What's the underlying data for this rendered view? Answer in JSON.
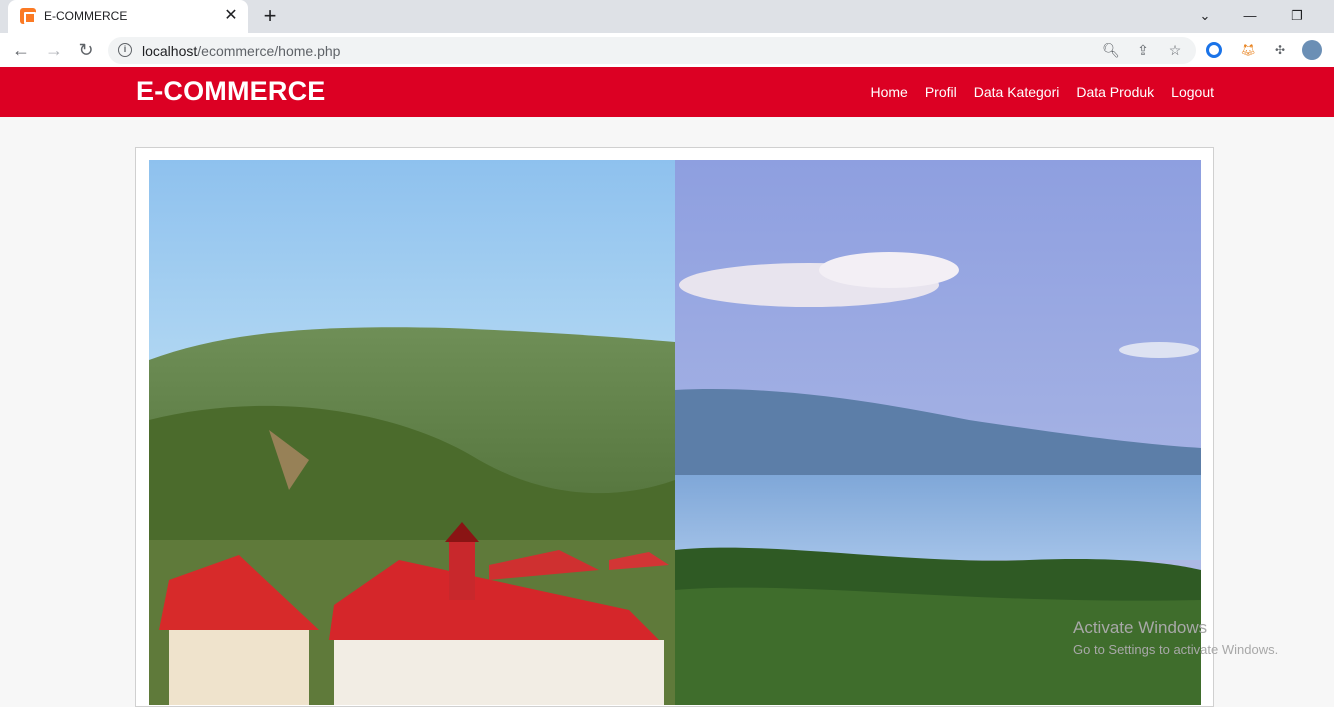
{
  "browser": {
    "tab_title": "E-COMMERCE",
    "url_host": "localhost",
    "url_path": "/ecommerce/home.php"
  },
  "site": {
    "brand": "E-COMMERCE",
    "nav": [
      "Home",
      "Profil",
      "Data Kategori",
      "Data Produk",
      "Logout"
    ]
  },
  "banner": {
    "left_image": "mountain-town-with-red-roof-buildings",
    "right_image": "lake-with-hills-and-clouds"
  },
  "watermark": {
    "line1": "Activate Windows",
    "line2": "Go to Settings to activate Windows."
  },
  "colors": {
    "header_red": "#dc0023",
    "page_bg": "#f7f7f7"
  }
}
